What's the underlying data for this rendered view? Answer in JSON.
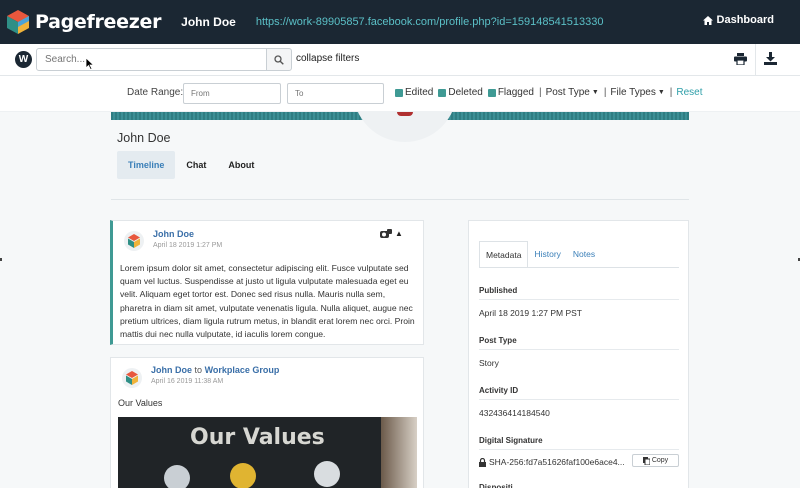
{
  "topbar": {
    "brand": "Pagefreezer",
    "user": "John Doe",
    "url": "https://work-89905857.facebook.com/profile.php?id=159148541513330",
    "dashboard": "Dashboard"
  },
  "search": {
    "placeholder": "Search...",
    "collapse_label": "collapse filters"
  },
  "filters": {
    "date_range_label": "Date Range:",
    "from_placeholder": "From",
    "to_placeholder": "To",
    "edited": "Edited",
    "deleted": "Deleted",
    "flagged": "Flagged",
    "post_type": "Post Type",
    "file_types": "File Types",
    "reset": "Reset"
  },
  "profile": {
    "name": "John Doe",
    "tabs": [
      "Timeline",
      "Chat",
      "About"
    ],
    "active_tab": "Timeline"
  },
  "posts": [
    {
      "author": "John Doe",
      "date": "April 18 2019 1:27 PM",
      "body": "Lorem ipsum dolor sit amet, consectetur adipiscing elit. Fusce vulputate sed quam vel luctus. Suspendisse at justo ut ligula vulputate malesuada eget eu velit. Aliquam eget tortor est. Donec sed risus nulla. Mauris nulla sem, pharetra in diam sit amet, vulputate venenatis ligula. Nulla aliquet, augue nec pretium ultrices, diam ligula rutrum metus, in blandit erat lorem nec orci. Proin mattis dui nec nulla vulputate, id iaculis lorem congue."
    },
    {
      "author": "John Doe",
      "connector": "to",
      "group": "Workplace Group",
      "date": "April 16 2019 11:38 AM",
      "text": "Our Values",
      "image_text": "Our Values"
    }
  ],
  "panel": {
    "tabs": [
      "Metadata",
      "History",
      "Notes"
    ],
    "active_tab": "Metadata",
    "fields": [
      {
        "label": "Published",
        "value": "April 18 2019 1:27 PM PST"
      },
      {
        "label": "Post Type",
        "value": "Story"
      },
      {
        "label": "Activity ID",
        "value": "432436414184540"
      }
    ],
    "signature_label": "Digital Signature",
    "signature_value": "SHA-256:fd7a51626faf100e6ace4...",
    "copy_label": "Copy"
  },
  "colors": {
    "topbar": "#1b2733",
    "accent_teal": "#3f9a94",
    "link_blue": "#3a7fb8"
  }
}
